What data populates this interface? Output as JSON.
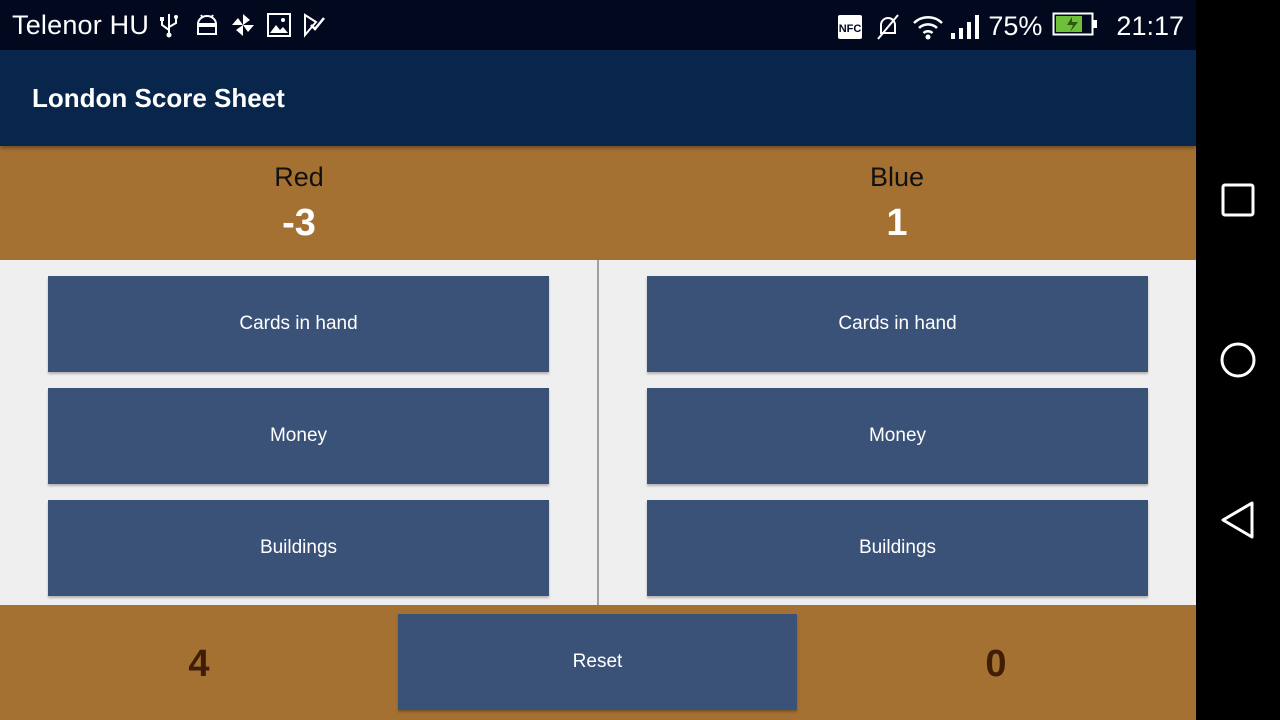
{
  "status_bar": {
    "carrier": "Telenor HU",
    "left_icons": [
      "usb-icon",
      "android-debug-icon",
      "pinwheel-icon",
      "image-icon",
      "checkbox-icon"
    ],
    "right_icons": [
      "nfc-icon",
      "mute-icon",
      "wifi-icon",
      "signal-icon",
      "battery-icon"
    ],
    "battery_percent": "75%",
    "battery_level": 0.75,
    "time": "21:17"
  },
  "app_bar": {
    "title": "London Score Sheet"
  },
  "players": [
    {
      "name": "Red",
      "score": "-3",
      "footer_value": "4"
    },
    {
      "name": "Blue",
      "score": "1",
      "footer_value": "0"
    }
  ],
  "buttons": {
    "cards": "Cards in hand",
    "money": "Money",
    "buildings": "Buildings",
    "reset": "Reset"
  },
  "colors": {
    "app_bar": "#08264b",
    "header_footer": "#a57132",
    "button": "#3a5278",
    "footer_number": "#3f1e05"
  },
  "nav_bar": {
    "icons": [
      "recent-apps-icon",
      "home-icon",
      "back-icon"
    ]
  }
}
